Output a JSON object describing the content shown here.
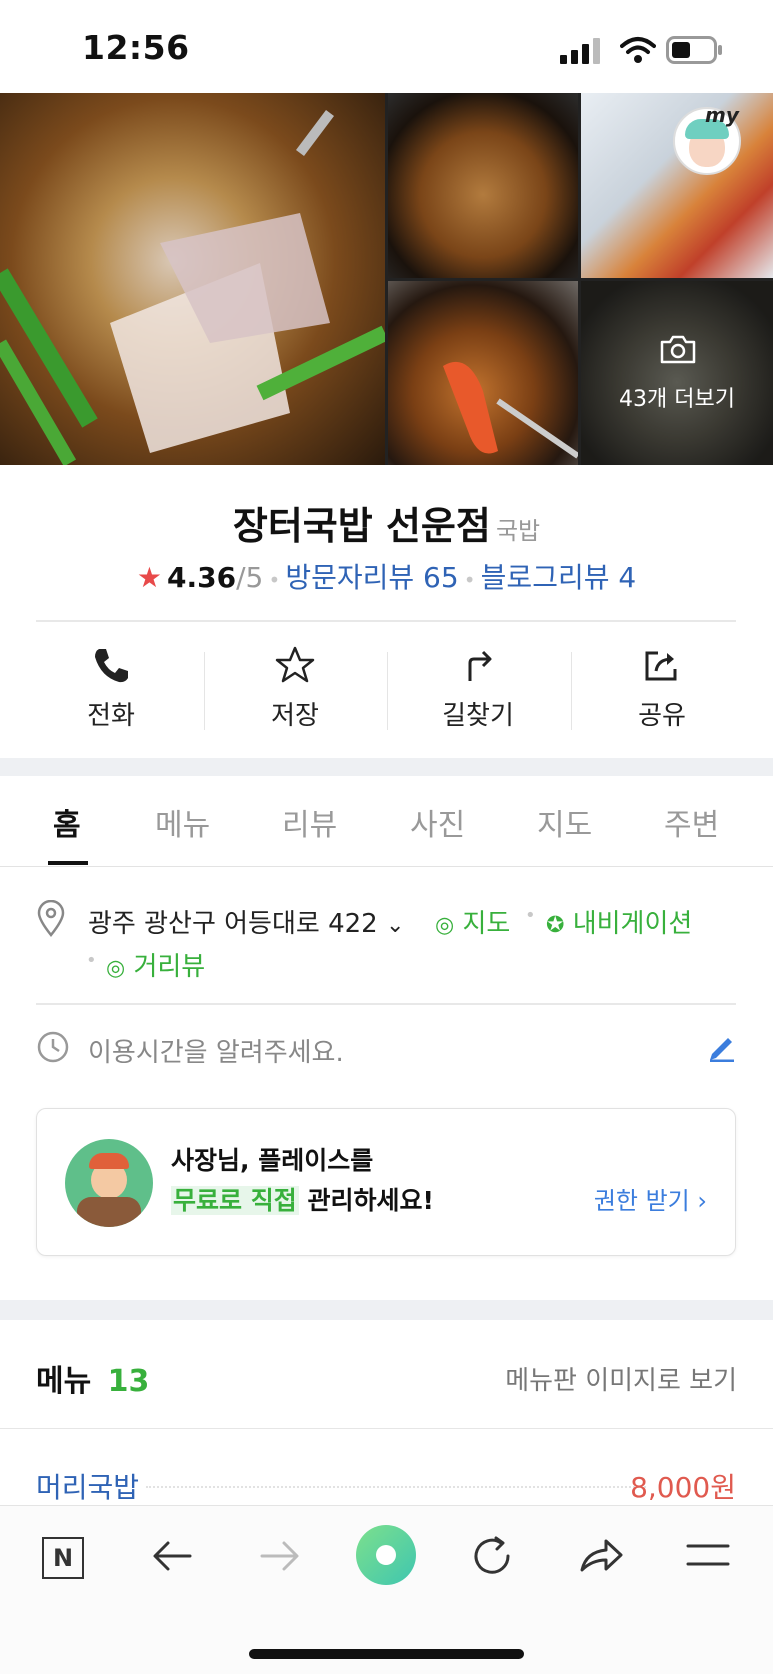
{
  "status": {
    "time": "12:56"
  },
  "photos": {
    "more_label": "43개 더보기",
    "profile_badge": "my"
  },
  "place": {
    "name": "장터국밥 선운점",
    "category": "국밥",
    "rating": "4.36",
    "rating_max": "/5",
    "visitor_reviews": "방문자리뷰 65",
    "blog_reviews": "블로그리뷰 4"
  },
  "actions": [
    {
      "label": "전화",
      "icon": "phone-icon"
    },
    {
      "label": "저장",
      "icon": "star-icon"
    },
    {
      "label": "길찾기",
      "icon": "directions-icon"
    },
    {
      "label": "공유",
      "icon": "share-icon"
    }
  ],
  "tabs": [
    "홈",
    "메뉴",
    "리뷰",
    "사진",
    "지도",
    "주변"
  ],
  "active_tab": "홈",
  "info": {
    "address": "광주 광산구 어등대로 422",
    "map_link": "지도",
    "nav_link": "내비게이션",
    "street_view_link": "거리뷰",
    "hours_prompt": "이용시간을 알려주세요."
  },
  "owner_banner": {
    "line1": "사장님, 플레이스를",
    "highlight": "무료로 직접",
    "line2_rest": "관리하세요!",
    "cta": "권한 받기 ›"
  },
  "menu_section": {
    "title": "메뉴",
    "count": "13",
    "view_image_link": "메뉴판 이미지로 보기",
    "items": [
      {
        "name": "머리국밥",
        "price": "8,000원"
      }
    ]
  },
  "colors": {
    "accent_green": "#38b03c",
    "link_blue": "#2f63b5",
    "price_red": "#e05a4f",
    "star_red": "#e84a4a"
  }
}
